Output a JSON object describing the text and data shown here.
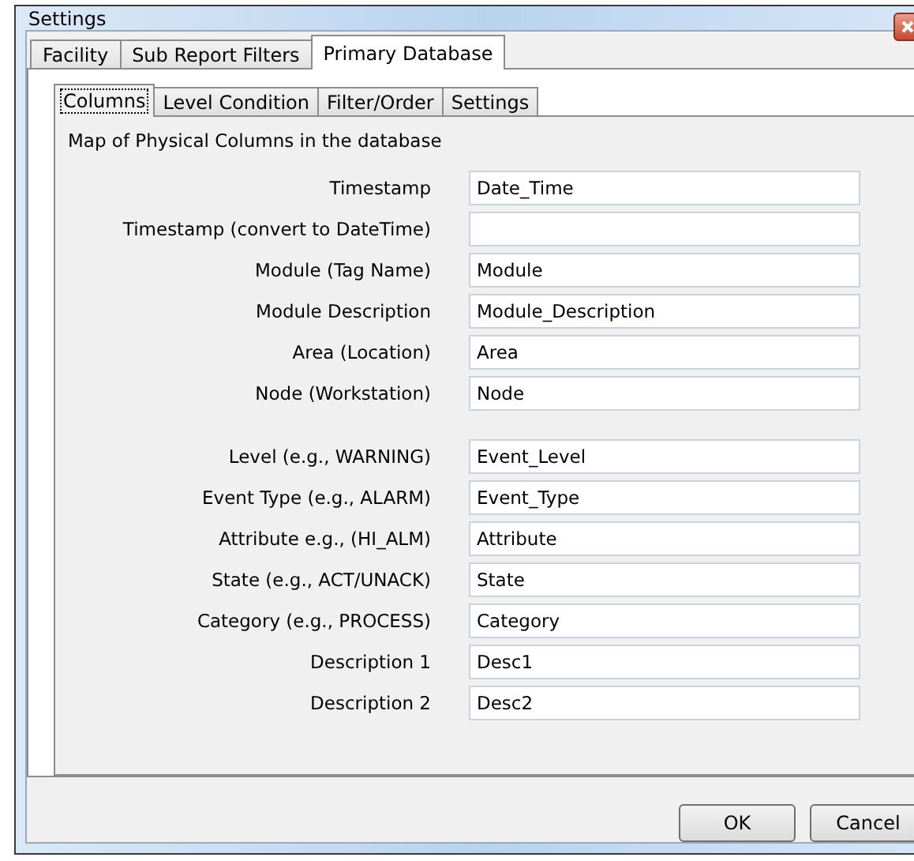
{
  "window": {
    "title": "Settings"
  },
  "tabs": [
    {
      "label": "Facility",
      "selected": false
    },
    {
      "label": "Sub Report Filters",
      "selected": false
    },
    {
      "label": "Primary Database",
      "selected": true
    }
  ],
  "subtabs": [
    {
      "label": "Columns",
      "selected": true
    },
    {
      "label": "Level Condition",
      "selected": false
    },
    {
      "label": "Filter/Order",
      "selected": false
    },
    {
      "label": "Settings",
      "selected": false
    }
  ],
  "section_label": "Map of Physical Columns in the database",
  "field_groups": [
    [
      {
        "label": "Timestamp",
        "value": "Date_Time"
      },
      {
        "label": "Timestamp (convert to DateTime)"
      },
      {
        "label": "Module  (Tag Name)",
        "value": "Module"
      },
      {
        "label": "Module Description",
        "value": "Module_Description"
      },
      {
        "label": "Area (Location)",
        "value": "Area"
      },
      {
        "label": "Node (Workstation)",
        "value": "Node"
      }
    ],
    [
      {
        "label": "Level (e.g., WARNING)",
        "value": "Event_Level"
      },
      {
        "label": "Event Type (e.g., ALARM)",
        "value": "Event_Type"
      },
      {
        "label": "Attribute e.g., (HI_ALM)",
        "value": "Attribute"
      },
      {
        "label": "State (e.g., ACT/UNACK)",
        "value": "State"
      },
      {
        "label": "Category (e.g., PROCESS)",
        "value": "Category"
      },
      {
        "label": "Description 1",
        "value": "Desc1"
      },
      {
        "label": "Description 2",
        "value": "Desc2"
      }
    ]
  ],
  "buttons": [
    "OK",
    "Cancel"
  ]
}
